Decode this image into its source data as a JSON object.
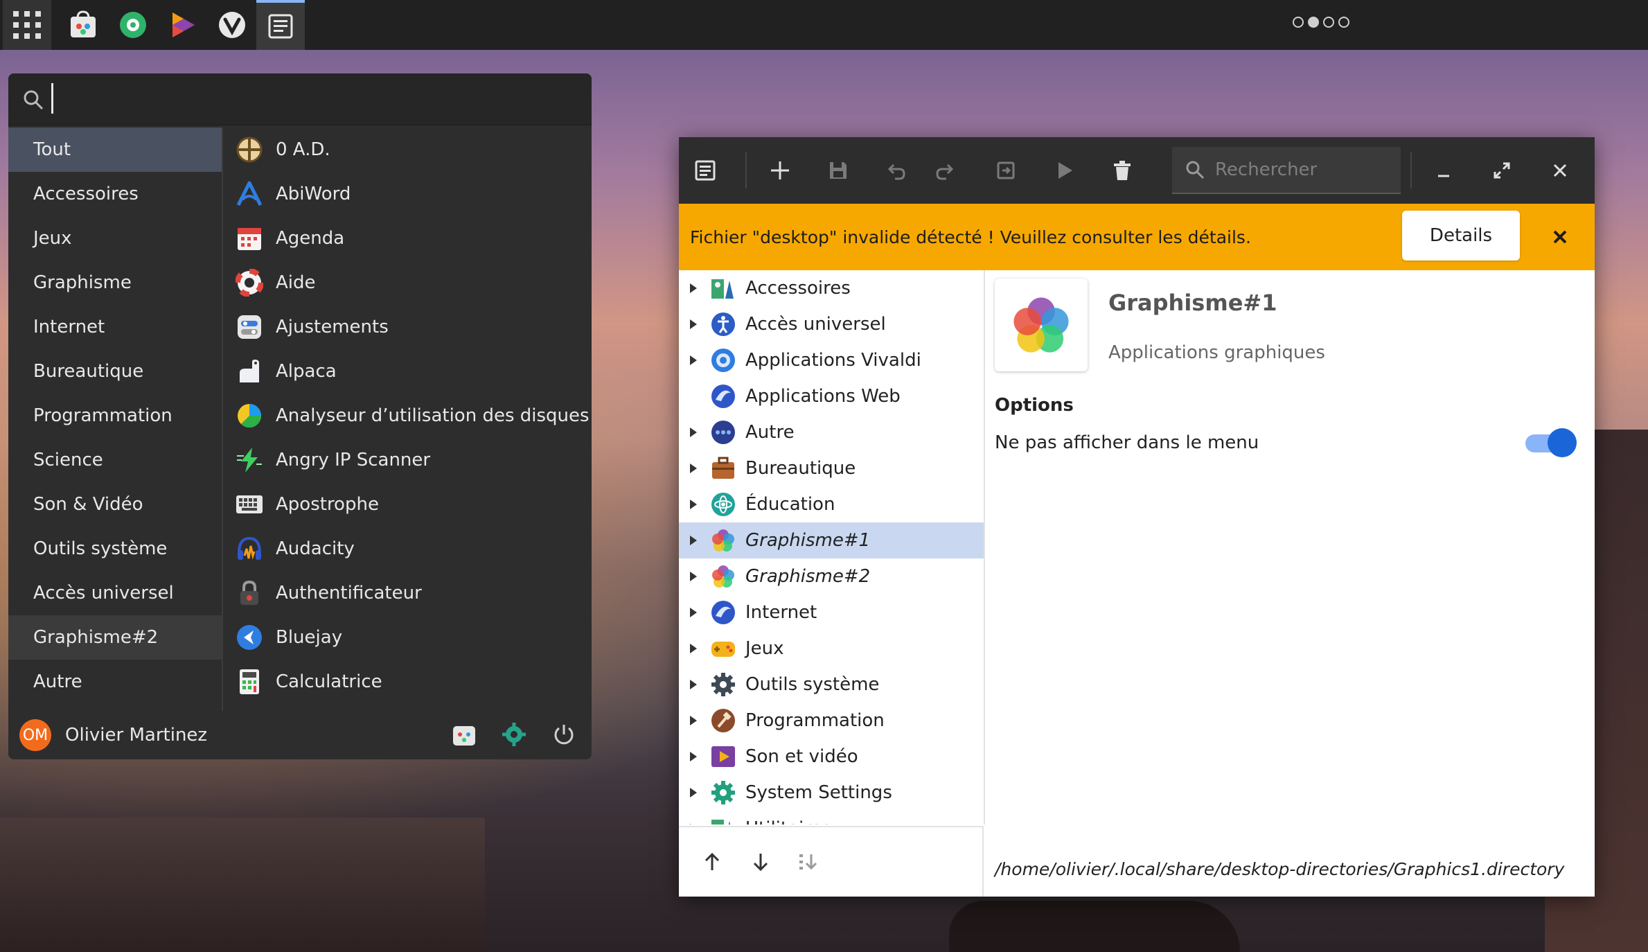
{
  "menu": {
    "search_placeholder": "",
    "categories": [
      "Tout",
      "Accessoires",
      "Jeux",
      "Graphisme",
      "Internet",
      "Bureautique",
      "Programmation",
      "Science",
      "Son & Vidéo",
      "Outils système",
      "Accès universel",
      "Graphisme#2",
      "Autre"
    ],
    "selected_category": "Tout",
    "apps": [
      "0 A.D.",
      "AbiWord",
      "Agenda",
      "Aide",
      "Ajustements",
      "Alpaca",
      "Analyseur d’utilisation des disques",
      "Angry IP Scanner",
      "Apostrophe",
      "Audacity",
      "Authentificateur",
      "Bluejay",
      "Calculatrice"
    ],
    "user": {
      "initials": "OM",
      "name": "Olivier Martinez"
    }
  },
  "editor": {
    "search_placeholder": "Rechercher",
    "banner": {
      "text": "Fichier \"desktop\" invalide détecté ! Veuillez consulter les détails.",
      "details_label": "Details"
    },
    "tree": [
      "Accessoires",
      "Accès universel",
      "Applications Vivaldi",
      "Applications Web",
      "Autre",
      "Bureautique",
      "Éducation",
      "Graphisme#1",
      "Graphisme#2",
      "Internet",
      "Jeux",
      "Outils système",
      "Programmation",
      "Son et vidéo",
      "System Settings",
      "Utilitaires"
    ],
    "selected": "Graphisme#1",
    "detail": {
      "name": "Graphisme#1",
      "comment": "Applications graphiques",
      "options_label": "Options",
      "hide_label": "Ne pas afficher dans le menu",
      "hide_enabled": true,
      "path": "/home/olivier/.local/share/desktop-directories/Graphics1.directory"
    }
  },
  "colors": {
    "accent": "#1a66d9",
    "banner": "#f7a800",
    "selection": "#c9d8f0"
  }
}
